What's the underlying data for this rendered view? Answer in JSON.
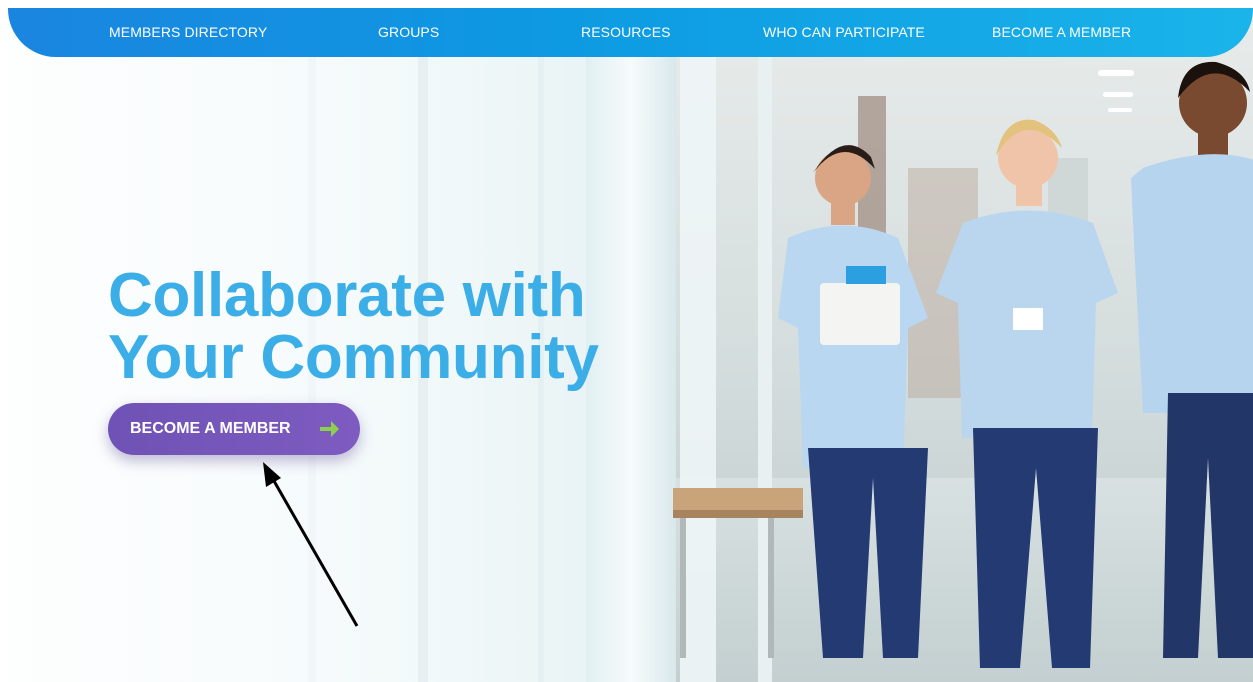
{
  "nav": {
    "items": [
      {
        "label": "MEMBERS DIRECTORY"
      },
      {
        "label": "GROUPS"
      },
      {
        "label": "RESOURCES"
      },
      {
        "label": "WHO CAN PARTICIPATE"
      },
      {
        "label": "BECOME A MEMBER"
      }
    ]
  },
  "hero": {
    "headline_line1": "Collaborate with",
    "headline_line2": "Your Community",
    "cta_label": "BECOME A MEMBER",
    "cta_icon": "arrow-right-icon"
  },
  "colors": {
    "nav_start": "#1a85e0",
    "nav_end": "#1ab4ea",
    "headline": "#3baee7",
    "cta_background": "#7457b9",
    "cta_arrow": "#8bd14f"
  }
}
